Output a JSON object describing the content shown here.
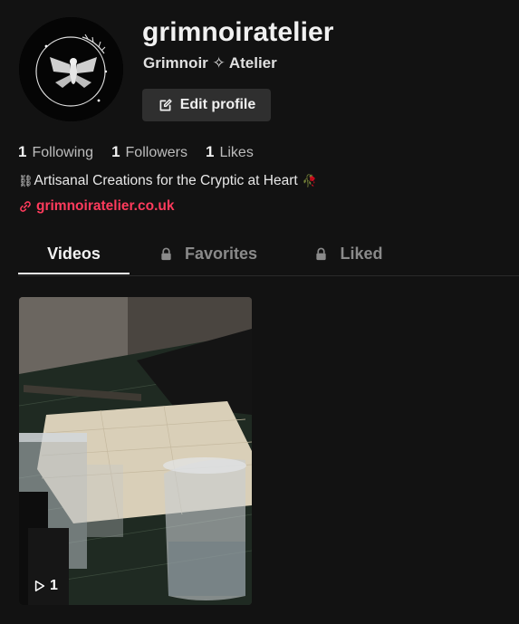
{
  "profile": {
    "username": "grimnoiratelier",
    "display_name": "Grimnoir ✧ Atelier",
    "edit_button_label": "Edit profile",
    "avatar_icon": "moth-moon-logo"
  },
  "stats": [
    {
      "value": "1",
      "label": "Following"
    },
    {
      "value": "1",
      "label": "Followers"
    },
    {
      "value": "1",
      "label": "Likes"
    }
  ],
  "bio": {
    "prefix_emoji": "⛓",
    "text": "Artisanal Creations for the Cryptic at Heart",
    "suffix_emoji": "🥀"
  },
  "link": {
    "text": "grimnoiratelier.co.uk",
    "icon": "link-icon"
  },
  "tabs": [
    {
      "label": "Videos",
      "locked": false,
      "active": true
    },
    {
      "label": "Favorites",
      "locked": true,
      "active": false
    },
    {
      "label": "Liked",
      "locked": true,
      "active": false
    }
  ],
  "videos": [
    {
      "play_count": "1",
      "icon": "play-outline-icon"
    }
  ],
  "colors": {
    "background": "#121212",
    "accent_link": "#ff3b5c",
    "button_bg": "#2f2f2f"
  }
}
